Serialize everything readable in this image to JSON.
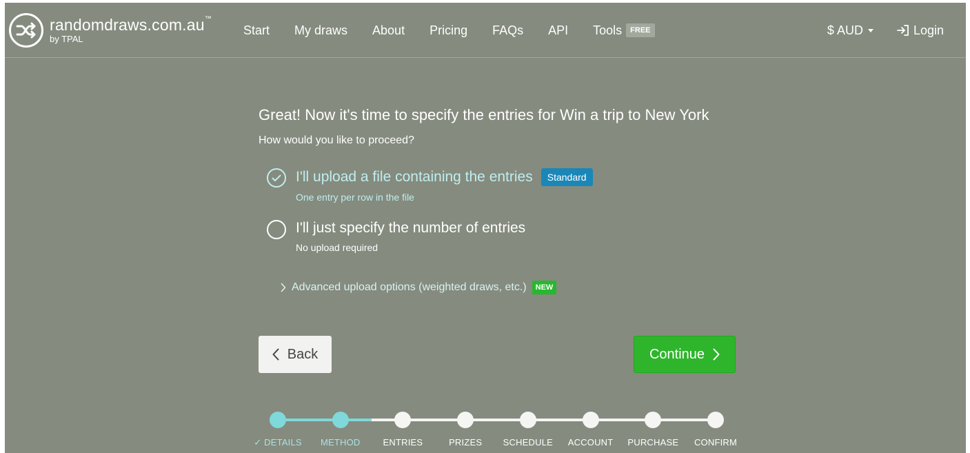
{
  "brand": {
    "name": "randomdraws.com.au",
    "tm": "™",
    "by": "by TPAL"
  },
  "nav": {
    "links": [
      "Start",
      "My draws",
      "About",
      "Pricing",
      "FAQs",
      "API",
      "Tools"
    ],
    "tools_badge": "FREE",
    "currency": "$ AUD",
    "login": "Login"
  },
  "main": {
    "heading": "Great! Now it's time to specify the entries for Win a trip to New York",
    "subheading": "How would you like to proceed?",
    "options": [
      {
        "title": "I'll upload a file containing the entries",
        "badge": "Standard",
        "subtitle": "One entry per row in the file",
        "selected": true
      },
      {
        "title": "I'll just specify the number of entries",
        "subtitle": "No upload required",
        "selected": false
      }
    ],
    "advanced": {
      "label": "Advanced upload options (weighted draws, etc.)",
      "badge": "NEW"
    },
    "back_label": "Back",
    "continue_label": "Continue"
  },
  "steps": [
    {
      "label": "✓ DETAILS",
      "done": true
    },
    {
      "label": "METHOD",
      "done": true
    },
    {
      "label": "ENTRIES",
      "done": false
    },
    {
      "label": "PRIZES",
      "done": false
    },
    {
      "label": "SCHEDULE",
      "done": false
    },
    {
      "label": "ACCOUNT",
      "done": false
    },
    {
      "label": "PURCHASE",
      "done": false
    },
    {
      "label": "CONFIRM",
      "done": false
    }
  ],
  "colors": {
    "background": "#858b7e",
    "accent_cyan": "#7fd8d9",
    "standard_badge": "#1a87b8",
    "continue_green": "#2eb52c",
    "new_badge": "#26b82e"
  }
}
